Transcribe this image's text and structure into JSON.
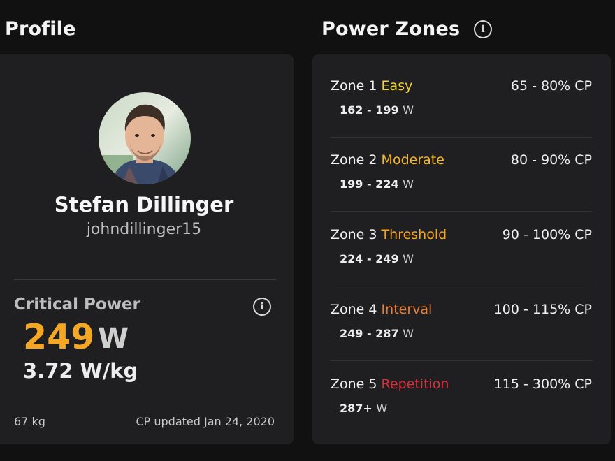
{
  "profile": {
    "title": "Profile",
    "name": "Stefan Dillinger",
    "username": "johndillinger15",
    "critical_power": {
      "label": "Critical Power",
      "value": "249",
      "unit": "W",
      "wkg": "3.72 W/kg"
    },
    "weight": "67 kg",
    "cp_updated": "CP updated Jan 24, 2020",
    "info_icon": "info-icon"
  },
  "zones": {
    "title": "Power Zones",
    "info_icon": "info-icon",
    "items": [
      {
        "prefix": "Zone 1",
        "label": "Easy",
        "color": "#f2d32b",
        "percent": "65 - 80% CP",
        "watts": "162 - 199",
        "unit": "W"
      },
      {
        "prefix": "Zone 2",
        "label": "Moderate",
        "color": "#f5b82a",
        "percent": "80 - 90% CP",
        "watts": "199 - 224",
        "unit": "W"
      },
      {
        "prefix": "Zone 3",
        "label": "Threshold",
        "color": "#f5a623",
        "percent": "90 - 100% CP",
        "watts": "224 - 249",
        "unit": "W"
      },
      {
        "prefix": "Zone 4",
        "label": "Interval",
        "color": "#ef7d2e",
        "percent": "100 - 115% CP",
        "watts": "249 - 287",
        "unit": "W"
      },
      {
        "prefix": "Zone 5",
        "label": "Repetition",
        "color": "#d9303e",
        "percent": "115 - 300% CP",
        "watts": "287+",
        "unit": "W"
      }
    ]
  }
}
